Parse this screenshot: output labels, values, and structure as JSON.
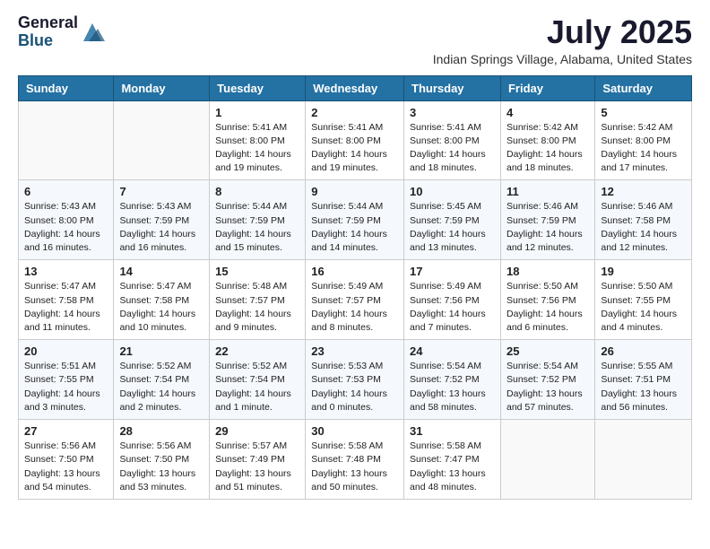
{
  "logo": {
    "general": "General",
    "blue": "Blue"
  },
  "title": "July 2025",
  "subtitle": "Indian Springs Village, Alabama, United States",
  "weekdays": [
    "Sunday",
    "Monday",
    "Tuesday",
    "Wednesday",
    "Thursday",
    "Friday",
    "Saturday"
  ],
  "weeks": [
    [
      {
        "day": "",
        "info": ""
      },
      {
        "day": "",
        "info": ""
      },
      {
        "day": "1",
        "info": "Sunrise: 5:41 AM\nSunset: 8:00 PM\nDaylight: 14 hours and 19 minutes."
      },
      {
        "day": "2",
        "info": "Sunrise: 5:41 AM\nSunset: 8:00 PM\nDaylight: 14 hours and 19 minutes."
      },
      {
        "day": "3",
        "info": "Sunrise: 5:41 AM\nSunset: 8:00 PM\nDaylight: 14 hours and 18 minutes."
      },
      {
        "day": "4",
        "info": "Sunrise: 5:42 AM\nSunset: 8:00 PM\nDaylight: 14 hours and 18 minutes."
      },
      {
        "day": "5",
        "info": "Sunrise: 5:42 AM\nSunset: 8:00 PM\nDaylight: 14 hours and 17 minutes."
      }
    ],
    [
      {
        "day": "6",
        "info": "Sunrise: 5:43 AM\nSunset: 8:00 PM\nDaylight: 14 hours and 16 minutes."
      },
      {
        "day": "7",
        "info": "Sunrise: 5:43 AM\nSunset: 7:59 PM\nDaylight: 14 hours and 16 minutes."
      },
      {
        "day": "8",
        "info": "Sunrise: 5:44 AM\nSunset: 7:59 PM\nDaylight: 14 hours and 15 minutes."
      },
      {
        "day": "9",
        "info": "Sunrise: 5:44 AM\nSunset: 7:59 PM\nDaylight: 14 hours and 14 minutes."
      },
      {
        "day": "10",
        "info": "Sunrise: 5:45 AM\nSunset: 7:59 PM\nDaylight: 14 hours and 13 minutes."
      },
      {
        "day": "11",
        "info": "Sunrise: 5:46 AM\nSunset: 7:59 PM\nDaylight: 14 hours and 12 minutes."
      },
      {
        "day": "12",
        "info": "Sunrise: 5:46 AM\nSunset: 7:58 PM\nDaylight: 14 hours and 12 minutes."
      }
    ],
    [
      {
        "day": "13",
        "info": "Sunrise: 5:47 AM\nSunset: 7:58 PM\nDaylight: 14 hours and 11 minutes."
      },
      {
        "day": "14",
        "info": "Sunrise: 5:47 AM\nSunset: 7:58 PM\nDaylight: 14 hours and 10 minutes."
      },
      {
        "day": "15",
        "info": "Sunrise: 5:48 AM\nSunset: 7:57 PM\nDaylight: 14 hours and 9 minutes."
      },
      {
        "day": "16",
        "info": "Sunrise: 5:49 AM\nSunset: 7:57 PM\nDaylight: 14 hours and 8 minutes."
      },
      {
        "day": "17",
        "info": "Sunrise: 5:49 AM\nSunset: 7:56 PM\nDaylight: 14 hours and 7 minutes."
      },
      {
        "day": "18",
        "info": "Sunrise: 5:50 AM\nSunset: 7:56 PM\nDaylight: 14 hours and 6 minutes."
      },
      {
        "day": "19",
        "info": "Sunrise: 5:50 AM\nSunset: 7:55 PM\nDaylight: 14 hours and 4 minutes."
      }
    ],
    [
      {
        "day": "20",
        "info": "Sunrise: 5:51 AM\nSunset: 7:55 PM\nDaylight: 14 hours and 3 minutes."
      },
      {
        "day": "21",
        "info": "Sunrise: 5:52 AM\nSunset: 7:54 PM\nDaylight: 14 hours and 2 minutes."
      },
      {
        "day": "22",
        "info": "Sunrise: 5:52 AM\nSunset: 7:54 PM\nDaylight: 14 hours and 1 minute."
      },
      {
        "day": "23",
        "info": "Sunrise: 5:53 AM\nSunset: 7:53 PM\nDaylight: 14 hours and 0 minutes."
      },
      {
        "day": "24",
        "info": "Sunrise: 5:54 AM\nSunset: 7:52 PM\nDaylight: 13 hours and 58 minutes."
      },
      {
        "day": "25",
        "info": "Sunrise: 5:54 AM\nSunset: 7:52 PM\nDaylight: 13 hours and 57 minutes."
      },
      {
        "day": "26",
        "info": "Sunrise: 5:55 AM\nSunset: 7:51 PM\nDaylight: 13 hours and 56 minutes."
      }
    ],
    [
      {
        "day": "27",
        "info": "Sunrise: 5:56 AM\nSunset: 7:50 PM\nDaylight: 13 hours and 54 minutes."
      },
      {
        "day": "28",
        "info": "Sunrise: 5:56 AM\nSunset: 7:50 PM\nDaylight: 13 hours and 53 minutes."
      },
      {
        "day": "29",
        "info": "Sunrise: 5:57 AM\nSunset: 7:49 PM\nDaylight: 13 hours and 51 minutes."
      },
      {
        "day": "30",
        "info": "Sunrise: 5:58 AM\nSunset: 7:48 PM\nDaylight: 13 hours and 50 minutes."
      },
      {
        "day": "31",
        "info": "Sunrise: 5:58 AM\nSunset: 7:47 PM\nDaylight: 13 hours and 48 minutes."
      },
      {
        "day": "",
        "info": ""
      },
      {
        "day": "",
        "info": ""
      }
    ]
  ]
}
